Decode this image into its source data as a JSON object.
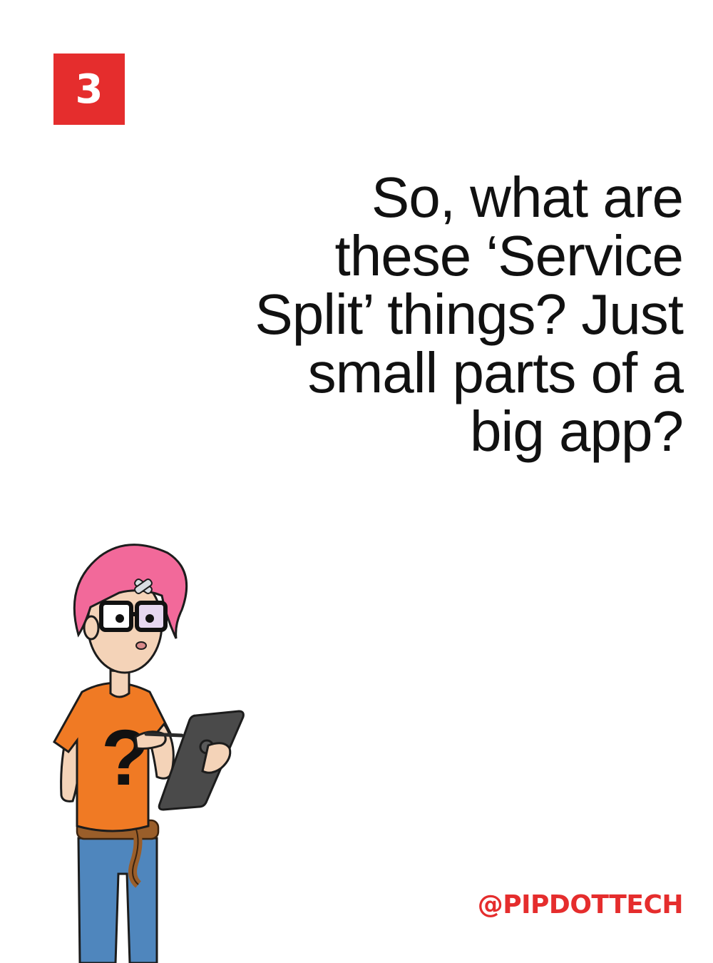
{
  "badge": {
    "number": "3",
    "color": "#e52d2d"
  },
  "question": {
    "lines": [
      "So, what are",
      "these ‘Service",
      "Split’ things? Just",
      "small parts of a",
      "big app?"
    ]
  },
  "handle": {
    "text": "@PIPDOTTECH",
    "color": "#e52d2d"
  },
  "illustration": {
    "icon": "character-illustration",
    "description_colors": {
      "hair": "#f2699a",
      "shirt": "#f07a24",
      "jeans": "#4f86bd",
      "tablet": "#4a4a4a"
    }
  }
}
